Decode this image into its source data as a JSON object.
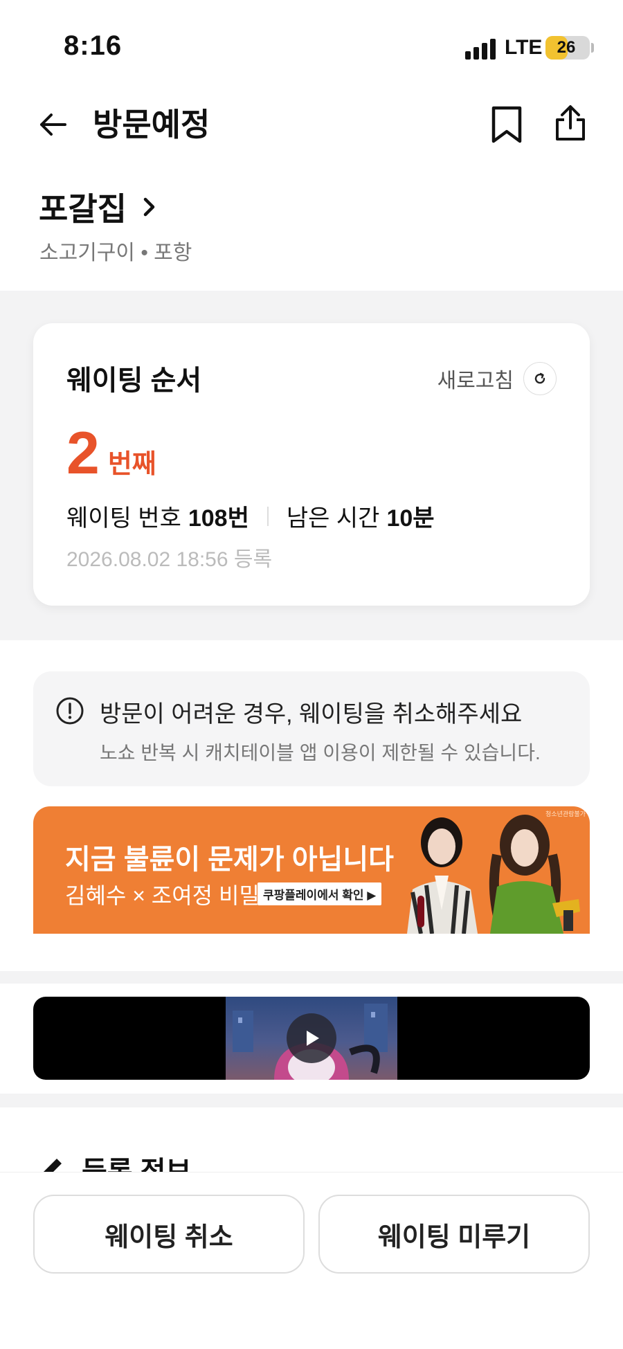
{
  "status_bar": {
    "time": "8:16",
    "network": "LTE",
    "battery": "26",
    "battery_level_percent": 26
  },
  "header": {
    "title": "방문예정",
    "back_icon": "arrow-left-icon",
    "bookmark_icon": "bookmark-icon",
    "share_icon": "share-icon"
  },
  "store": {
    "name": "포갈집",
    "meta": "소고기구이 • 포항"
  },
  "waiting_card": {
    "title": "웨이팅 순서",
    "refresh_label": "새로고침",
    "order_number": "2",
    "order_suffix": "번째",
    "waiting_number_label": "웨이팅 번호",
    "waiting_number_value": "108번",
    "remaining_label": "남은 시간",
    "remaining_value": "10분",
    "registered_at": "2026.08.02 18:56 등록",
    "accent_color": "#e8532a"
  },
  "notice": {
    "title": "방문이 어려운 경우, 웨이팅을 취소해주세요",
    "subtitle": "노쇼 반복 시 캐치테이블 앱 이용이 제한될 수 있습니다."
  },
  "ad": {
    "headline": "지금 불륜이 문제가 아닙니다",
    "sub": "김혜수 × 조여정 비밀",
    "cta": "쿠팡플레이에서 확인 ▶",
    "tag": "청소년관람불가",
    "background_color": "#ef7f34"
  },
  "video": {
    "play_icon": "play-icon"
  },
  "registration": {
    "title": "등록 정보",
    "icon": "pencil-icon"
  },
  "bottom": {
    "cancel_label": "웨이팅 취소",
    "postpone_label": "웨이팅 미루기"
  }
}
